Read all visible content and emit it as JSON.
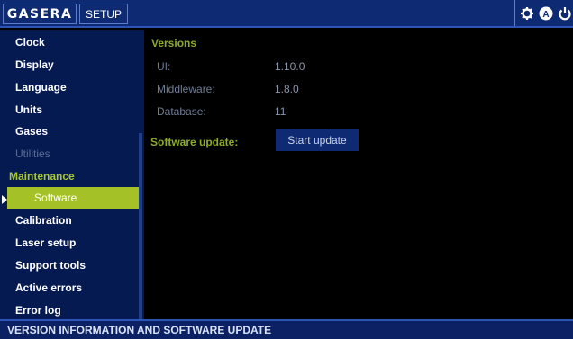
{
  "header": {
    "brand": "GASERA",
    "mode_tab": "SETUP",
    "icons": [
      "gear-icon",
      "auto-mode-icon",
      "power-icon"
    ]
  },
  "sidebar": {
    "items": [
      {
        "label": "Clock",
        "state": "normal"
      },
      {
        "label": "Display",
        "state": "normal"
      },
      {
        "label": "Language",
        "state": "normal"
      },
      {
        "label": "Units",
        "state": "normal"
      },
      {
        "label": "Gases",
        "state": "normal"
      },
      {
        "label": "Utilities",
        "state": "disabled"
      },
      {
        "label": "Maintenance",
        "state": "section"
      },
      {
        "label": "Software",
        "state": "selected"
      },
      {
        "label": "Calibration",
        "state": "normal"
      },
      {
        "label": "Laser setup",
        "state": "normal"
      },
      {
        "label": "Support tools",
        "state": "normal"
      },
      {
        "label": "Active errors",
        "state": "normal"
      },
      {
        "label": "Error log",
        "state": "normal"
      }
    ]
  },
  "versions": {
    "title": "Versions",
    "rows": [
      {
        "label": "UI:",
        "value": "1.10.0"
      },
      {
        "label": "Middleware:",
        "value": "1.8.0"
      },
      {
        "label": "Database:",
        "value": "11"
      }
    ]
  },
  "software_update": {
    "label": "Software update:",
    "button": "Start update"
  },
  "footer": {
    "status": "VERSION INFORMATION AND SOFTWARE UPDATE"
  },
  "colors": {
    "accent": "#a4c227",
    "header_blue": "#0e2a73",
    "sidebar_blue": "#061a52"
  }
}
